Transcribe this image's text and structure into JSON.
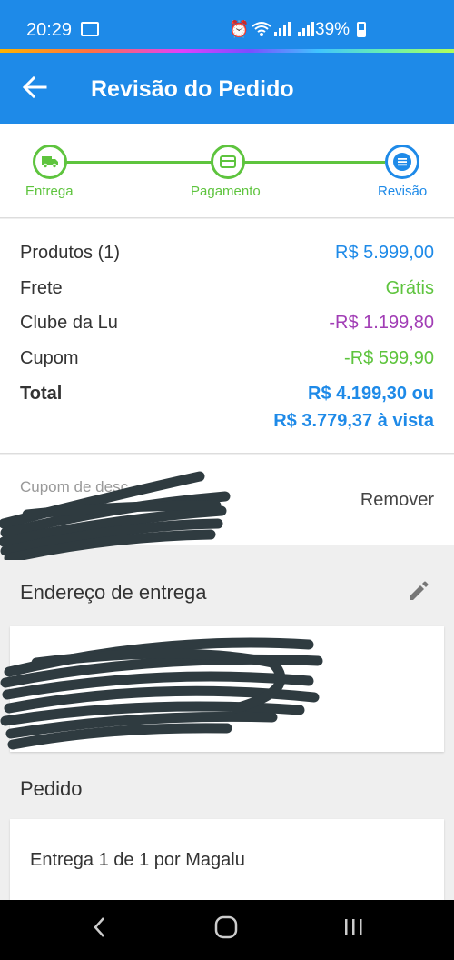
{
  "status_bar": {
    "time": "20:29",
    "battery": "39%"
  },
  "app_bar": {
    "title": "Revisão do Pedido"
  },
  "stepper": {
    "steps": [
      {
        "label": "Entrega",
        "icon": "truck-icon"
      },
      {
        "label": "Pagamento",
        "icon": "card-icon"
      },
      {
        "label": "Revisão",
        "icon": "list-icon"
      }
    ]
  },
  "summary": {
    "products_label": "Produtos (1)",
    "products_value": "R$ 5.999,00",
    "shipping_label": "Frete",
    "shipping_value": "Grátis",
    "club_label": "Clube da Lu",
    "club_value": "-R$ 1.199,80",
    "coupon_label": "Cupom",
    "coupon_value": "-R$ 599,90",
    "total_label": "Total",
    "total_value_line1": "R$ 4.199,30 ou",
    "total_value_line2": "R$ 3.779,37 à vista"
  },
  "coupon_section": {
    "label": "Cupom de desc",
    "remove_label": "Remover"
  },
  "address_section": {
    "title": "Endereço de entrega"
  },
  "order_section": {
    "title": "Pedido",
    "delivery_text": "Entrega 1 de 1 por Magalu"
  },
  "colors": {
    "primary": "#1e8ae8",
    "green": "#5ec43e",
    "purple": "#a13db5"
  }
}
